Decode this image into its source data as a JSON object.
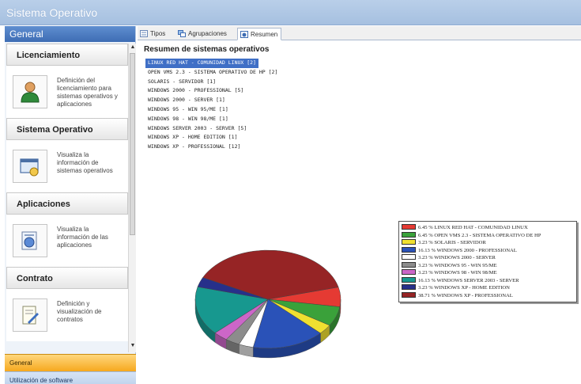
{
  "app": {
    "title": "Sistema Operativo"
  },
  "sidebar": {
    "header": "General",
    "sections": [
      {
        "title": "Licenciamiento",
        "desc": "Definición del licenciamiento para sistemas operativos y aplicaciones",
        "icon": "user-icon"
      },
      {
        "title": "Sistema Operativo",
        "desc": "Visualiza la información de sistemas operativos",
        "icon": "os-window-icon"
      },
      {
        "title": "Aplicaciones",
        "desc": "Visualiza la información de las aplicaciones",
        "icon": "applications-icon"
      },
      {
        "title": "Contrato",
        "desc": "Definición y visualización de contratos",
        "icon": "contract-icon"
      }
    ],
    "nav": [
      "General",
      "Utilización de software"
    ]
  },
  "tabs": [
    {
      "label": "Tipos",
      "icon": "types-icon"
    },
    {
      "label": "Agrupaciones",
      "icon": "groups-icon"
    },
    {
      "label": "Resumen",
      "icon": "summary-icon"
    }
  ],
  "main": {
    "heading": "Resumen de sistemas operativos",
    "items": [
      "LINUX RED HAT - COMUNIDAD LINUX [2]",
      "OPEN VMS 2.3 - SISTEMA OPERATIVO DE HP [2]",
      "SOLARIS - SERVIDOR [1]",
      "WINDOWS 2000 - PROFESSIONAL [5]",
      "WINDOWS 2000 - SERVER [1]",
      "WINDOWS 95 - WIN 95/ME [1]",
      "WINDOWS 98 - WIN 98/ME [1]",
      "WINDOWS SERVER 2003 - SERVER [5]",
      "WINDOWS XP - HOME EDITION [1]",
      "WINDOWS XP - PROFESSIONAL [12]"
    ]
  },
  "chart_data": {
    "type": "pie",
    "legend_position": "right",
    "slices": [
      {
        "label": "6.45 % LINUX RED HAT - COMUNIDAD LINUX",
        "value": 6.45,
        "color": "#e53a33"
      },
      {
        "label": "6.45 % OPEN VMS 2.3 - SISTEMA OPERATIVO DE HP",
        "value": 6.45,
        "color": "#3aa13a"
      },
      {
        "label": "3.23 % SOLARIS - SERVIDOR",
        "value": 3.23,
        "color": "#f0e030"
      },
      {
        "label": "16.13 % WINDOWS 2000 - PROFESSIONAL",
        "value": 16.13,
        "color": "#2a52b8"
      },
      {
        "label": "3.23 % WINDOWS 2000 - SERVER",
        "value": 3.23,
        "color": "#ffffff"
      },
      {
        "label": "3.23 % WINDOWS 95 - WIN 95/ME",
        "value": 3.23,
        "color": "#8c8c8c"
      },
      {
        "label": "3.23 % WINDOWS 98 - WIN 98/ME",
        "value": 3.23,
        "color": "#cc66c8"
      },
      {
        "label": "16.13 % WINDOWS SERVER 2003 - SERVER",
        "value": 16.13,
        "color": "#17988f"
      },
      {
        "label": "3.23 % WINDOWS XP - HOME EDITION",
        "value": 3.23,
        "color": "#27308a"
      },
      {
        "label": "38.71 % WINDOWS XP - PROFESSIONAL",
        "value": 38.71,
        "color": "#962425"
      }
    ]
  }
}
